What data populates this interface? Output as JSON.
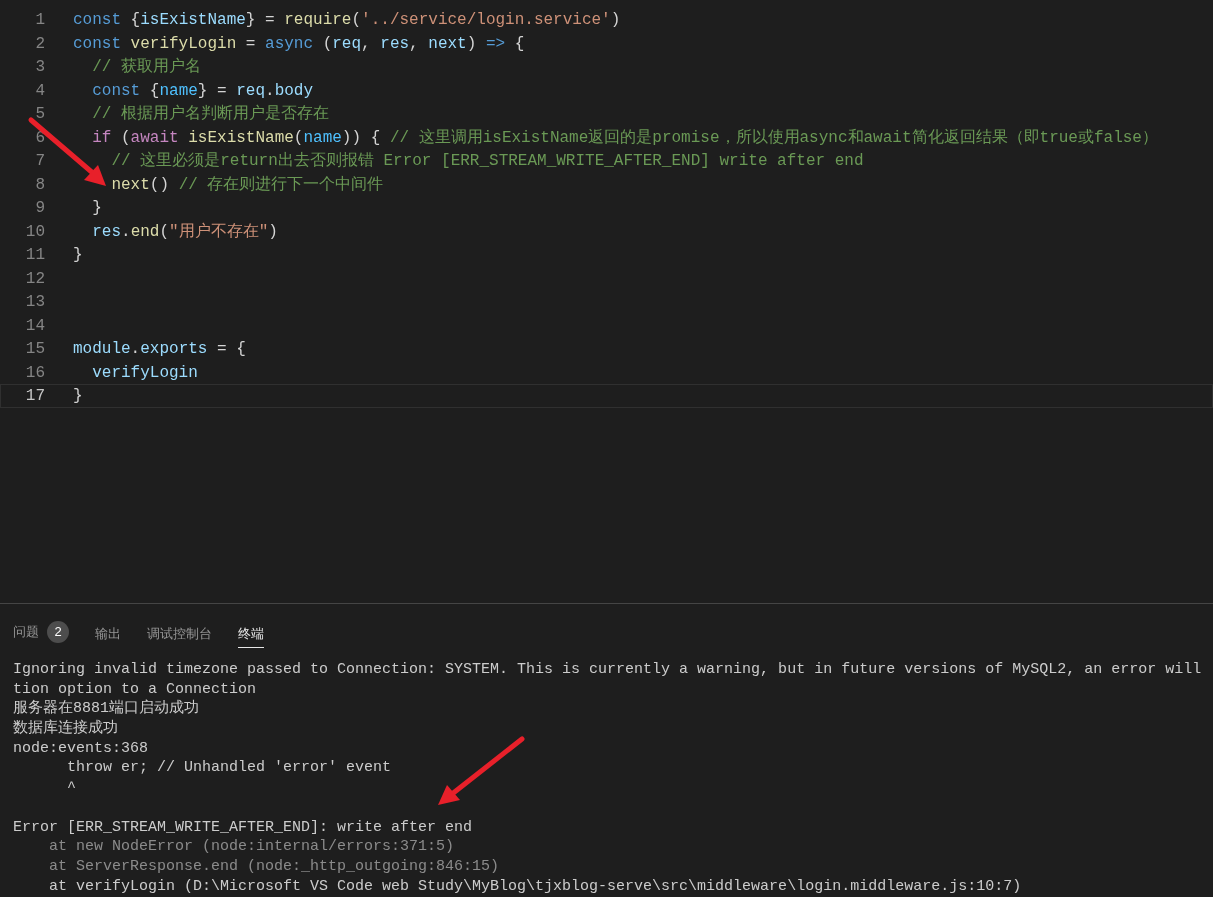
{
  "editor": {
    "lines": [
      {
        "number": "1",
        "current": false,
        "tokens": [
          {
            "text": "const ",
            "kind": "keyword"
          },
          {
            "text": "{",
            "kind": "plain"
          },
          {
            "text": "isExistName",
            "kind": "variable"
          },
          {
            "text": "} = ",
            "kind": "plain"
          },
          {
            "text": "require",
            "kind": "function"
          },
          {
            "text": "(",
            "kind": "plain"
          },
          {
            "text": "'../service/login.service'",
            "kind": "string"
          },
          {
            "text": ")",
            "kind": "plain"
          }
        ]
      },
      {
        "number": "2",
        "current": false,
        "tokens": [
          {
            "text": "const ",
            "kind": "keyword"
          },
          {
            "text": "verifyLogin",
            "kind": "function"
          },
          {
            "text": " = ",
            "kind": "plain"
          },
          {
            "text": "async",
            "kind": "keyword"
          },
          {
            "text": " (",
            "kind": "plain"
          },
          {
            "text": "req",
            "kind": "variable"
          },
          {
            "text": ", ",
            "kind": "plain"
          },
          {
            "text": "res",
            "kind": "variable"
          },
          {
            "text": ", ",
            "kind": "plain"
          },
          {
            "text": "next",
            "kind": "variable"
          },
          {
            "text": ") ",
            "kind": "plain"
          },
          {
            "text": "=>",
            "kind": "keyword"
          },
          {
            "text": " {",
            "kind": "plain"
          }
        ]
      },
      {
        "number": "3",
        "current": false,
        "tokens": [
          {
            "text": "  // 获取用户名",
            "kind": "comment"
          }
        ]
      },
      {
        "number": "4",
        "current": false,
        "tokens": [
          {
            "text": "  const ",
            "kind": "keyword"
          },
          {
            "text": "{",
            "kind": "plain"
          },
          {
            "text": "name",
            "kind": "constant"
          },
          {
            "text": "} = ",
            "kind": "plain"
          },
          {
            "text": "req",
            "kind": "variable"
          },
          {
            "text": ".",
            "kind": "plain"
          },
          {
            "text": "body",
            "kind": "variable"
          }
        ]
      },
      {
        "number": "5",
        "current": false,
        "tokens": [
          {
            "text": "  // 根据用户名判断用户是否存在",
            "kind": "comment"
          }
        ]
      },
      {
        "number": "6",
        "current": false,
        "tokens": [
          {
            "text": "  if",
            "kind": "control"
          },
          {
            "text": " (",
            "kind": "plain"
          },
          {
            "text": "await ",
            "kind": "control"
          },
          {
            "text": "isExistName",
            "kind": "function"
          },
          {
            "text": "(",
            "kind": "plain"
          },
          {
            "text": "name",
            "kind": "constant"
          },
          {
            "text": ")) { ",
            "kind": "plain"
          },
          {
            "text": "// 这里调用isExistName返回的是promise，所以使用async和await简化返回结果（即true或false）",
            "kind": "comment"
          }
        ]
      },
      {
        "number": "7",
        "current": false,
        "tokens": [
          {
            "text": "    // 这里必须是return出去否则报错 Error [ERR_STREAM_WRITE_AFTER_END] write after end",
            "kind": "comment"
          }
        ]
      },
      {
        "number": "8",
        "current": false,
        "tokens": [
          {
            "text": "    next",
            "kind": "function"
          },
          {
            "text": "() ",
            "kind": "plain"
          },
          {
            "text": "// 存在则进行下一个中间件",
            "kind": "comment"
          }
        ]
      },
      {
        "number": "9",
        "current": false,
        "tokens": [
          {
            "text": "  }",
            "kind": "plain"
          }
        ]
      },
      {
        "number": "10",
        "current": false,
        "tokens": [
          {
            "text": "  res",
            "kind": "variable"
          },
          {
            "text": ".",
            "kind": "plain"
          },
          {
            "text": "end",
            "kind": "function"
          },
          {
            "text": "(",
            "kind": "plain"
          },
          {
            "text": "\"用户不存在\"",
            "kind": "string"
          },
          {
            "text": ")",
            "kind": "plain"
          }
        ]
      },
      {
        "number": "11",
        "current": false,
        "tokens": [
          {
            "text": "}",
            "kind": "plain"
          }
        ]
      },
      {
        "number": "12",
        "current": false
      },
      {
        "number": "13",
        "current": false
      },
      {
        "number": "14",
        "current": false
      },
      {
        "number": "15",
        "current": false,
        "tokens": [
          {
            "text": "module",
            "kind": "variable"
          },
          {
            "text": ".",
            "kind": "plain"
          },
          {
            "text": "exports",
            "kind": "variable"
          },
          {
            "text": " = {",
            "kind": "plain"
          }
        ]
      },
      {
        "number": "16",
        "current": false,
        "tokens": [
          {
            "text": "  verifyLogin",
            "kind": "variable"
          }
        ]
      },
      {
        "number": "17",
        "current": true,
        "tokens": [
          {
            "text": "}",
            "kind": "plain"
          }
        ]
      }
    ]
  },
  "panel": {
    "tabs": [
      {
        "label": "问题",
        "badge": "2",
        "selected": false
      },
      {
        "label": "输出",
        "selected": false
      },
      {
        "label": "调试控制台",
        "selected": false
      },
      {
        "label": "终端",
        "selected": true
      }
    ],
    "terminal": [
      {
        "kind": "normal",
        "text": "Ignoring invalid timezone passed to Connection: SYSTEM. This is currently a warning, but in future versions of MySQL2, an error will"
      },
      {
        "kind": "normal",
        "text": "tion option to a Connection"
      },
      {
        "kind": "normal",
        "text": "服务器在8881端口启动成功"
      },
      {
        "kind": "normal",
        "text": "数据库连接成功"
      },
      {
        "kind": "normal",
        "text": "node:events:368"
      },
      {
        "kind": "normal",
        "text": "      throw er; // Unhandled 'error' event"
      },
      {
        "kind": "normal",
        "text": "      ^"
      },
      {
        "kind": "blank"
      },
      {
        "kind": "normal",
        "text": "Error [ERR_STREAM_WRITE_AFTER_END]: write after end"
      },
      {
        "kind": "dim",
        "text": "    at new NodeError (node:internal/errors:371:5)"
      },
      {
        "kind": "dim",
        "text": "    at ServerResponse.end (node:_http_outgoing:846:15)"
      },
      {
        "kind": "normal",
        "text": "    at verifyLogin (D:\\Microsoft VS Code web Study\\MyBlog\\tjxblog-serve\\src\\middleware\\login.middleware.js:10:7)"
      }
    ]
  }
}
